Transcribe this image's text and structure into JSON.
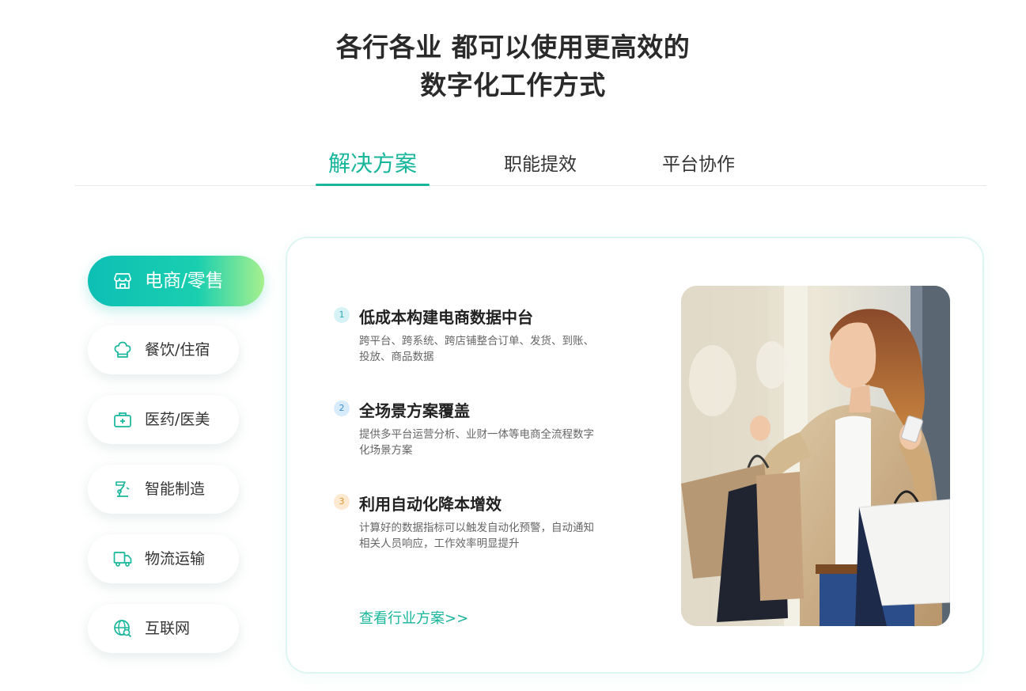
{
  "headline": {
    "line1": "各行各业 都可以使用更高效的",
    "line2": "数字化工作方式"
  },
  "tabs": [
    {
      "label": "解决方案"
    },
    {
      "label": "职能提效"
    },
    {
      "label": "平台协作"
    }
  ],
  "sidebar": {
    "items": [
      {
        "label": "电商/零售",
        "icon": "storefront-icon"
      },
      {
        "label": "餐饮/住宿",
        "icon": "chef-hat-icon"
      },
      {
        "label": "医药/医美",
        "icon": "medical-kit-icon"
      },
      {
        "label": "智能制造",
        "icon": "robotic-arm-icon"
      },
      {
        "label": "物流运输",
        "icon": "truck-icon"
      },
      {
        "label": "互联网",
        "icon": "globe-search-icon"
      }
    ]
  },
  "features": [
    {
      "num": "1",
      "title": "低成本构建电商数据中台",
      "desc": "跨平台、跨系统、跨店铺整合订单、发货、到账、投放、商品数据",
      "num_bg": "#d6f2f5",
      "num_color": "#2fa8b8"
    },
    {
      "num": "2",
      "title": "全场景方案覆盖",
      "desc": "提供多平台运营分析、业财一体等电商全流程数字化场景方案",
      "num_bg": "#d7ebfa",
      "num_color": "#3d8fd0"
    },
    {
      "num": "3",
      "title": "利用自动化降本增效",
      "desc": "计算好的数据指标可以触发自动化预警，自动通知相关人员响应，工作效率明显提升",
      "num_bg": "#fde9cf",
      "num_color": "#e0962e"
    }
  ],
  "more_link": "查看行业方案>>",
  "colors": {
    "accent": "#18b69b",
    "gradient_start": "#0dbfb4",
    "gradient_end": "#a6f08d"
  }
}
